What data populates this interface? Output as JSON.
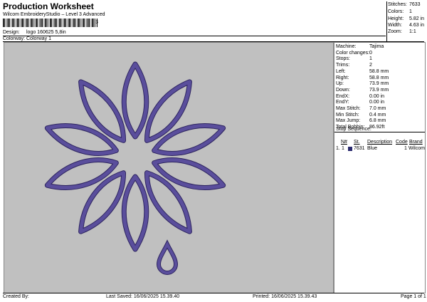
{
  "header": {
    "title": "Production Worksheet",
    "subtitle": "Wilcom EmbroideryStudio – Level 3 Advanced",
    "barcode_number": "3",
    "design_label": "Design:",
    "design_value": "logo 160625 5,8in",
    "colorway_label": "Colorway:",
    "colorway_value": "Colorway 1"
  },
  "summary": {
    "stitches_label": "Stitches:",
    "stitches": "7633",
    "colors_label": "Colors:",
    "colors": "1",
    "height_label": "Height:",
    "height": "5.82 in",
    "width_label": "Width:",
    "width": "4.63 in",
    "zoom_label": "Zoom:",
    "zoom": "1:1"
  },
  "details": [
    {
      "k": "Machine:",
      "v": "Tajima"
    },
    {
      "k": "Color changes:",
      "v": "0"
    },
    {
      "k": "Stops:",
      "v": "1"
    },
    {
      "k": "Trims:",
      "v": "2"
    },
    {
      "k": "Left:",
      "v": "58.8 mm"
    },
    {
      "k": "Right:",
      "v": "58.8 mm"
    },
    {
      "k": "Up:",
      "v": "73.9 mm"
    },
    {
      "k": "Down:",
      "v": "73.9 mm"
    },
    {
      "k": "EndX:",
      "v": "0.00 in"
    },
    {
      "k": "EndY:",
      "v": "0.00 in"
    },
    {
      "k": "Max Stitch:",
      "v": "7.0 mm"
    },
    {
      "k": "Min Stitch:",
      "v": "0.4 mm"
    },
    {
      "k": "Max Jump:",
      "v": "6.8 mm"
    },
    {
      "k": "Total Bobbin:",
      "v": "86.92ft"
    }
  ],
  "sequence": {
    "title": "Stop Sequence:",
    "headers": {
      "n": "N#",
      "stitches": "St.",
      "description": "Description",
      "code": "Code",
      "brand": "Brand"
    },
    "row": {
      "idx": "1.",
      "n": "1",
      "stitches": "7631",
      "description": "Blue",
      "code": "1",
      "brand": "Wilcom"
    },
    "thread_color": "#2a2a6e"
  },
  "footer": {
    "created_label": "Created By:",
    "last_saved": "Last Saved: 16/06/2025 15.39.40",
    "printed": "Printed: 16/06/2025 15.39.43",
    "page": "Page 1 of 1"
  },
  "design_colors": {
    "thread": "#5a4e9c",
    "outline": "#2e2560",
    "background": "#c0c0c0"
  }
}
